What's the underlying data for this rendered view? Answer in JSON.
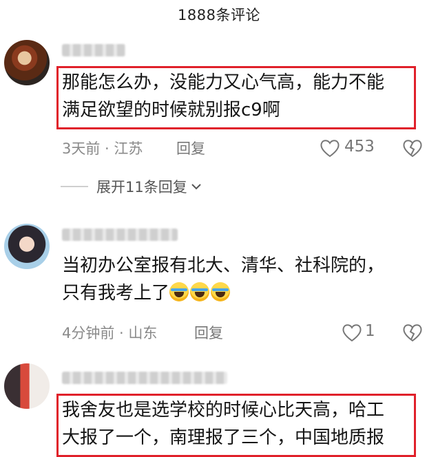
{
  "header": {
    "title": "1888条评论"
  },
  "comments": [
    {
      "text_lines": [
        "那能怎么办，没能力又心气高，能力不能",
        "满足欲望的时候就别报c9啊"
      ],
      "meta": "3天前 · 江苏",
      "reply_label": "回复",
      "likes": "453",
      "expand_label": "展开11条回复"
    },
    {
      "text_lines": [
        "当初办公室报有北大、清华、社科院的，",
        "只有我考上了"
      ],
      "emoji_count": 3,
      "meta": "4分钟前 · 山东",
      "reply_label": "回复",
      "likes": "1"
    },
    {
      "text_lines": [
        "我舍友也是选学校的时候心比天高，哈工",
        "大报了一个，南理报了三个，中国地质报"
      ]
    }
  ],
  "colors": {
    "highlight_box": "#e0202a",
    "meta_text": "#8a8a8a"
  },
  "icons": {
    "like": "heart-outline-icon",
    "dislike": "broken-heart-icon",
    "expand": "chevron-down-icon"
  }
}
